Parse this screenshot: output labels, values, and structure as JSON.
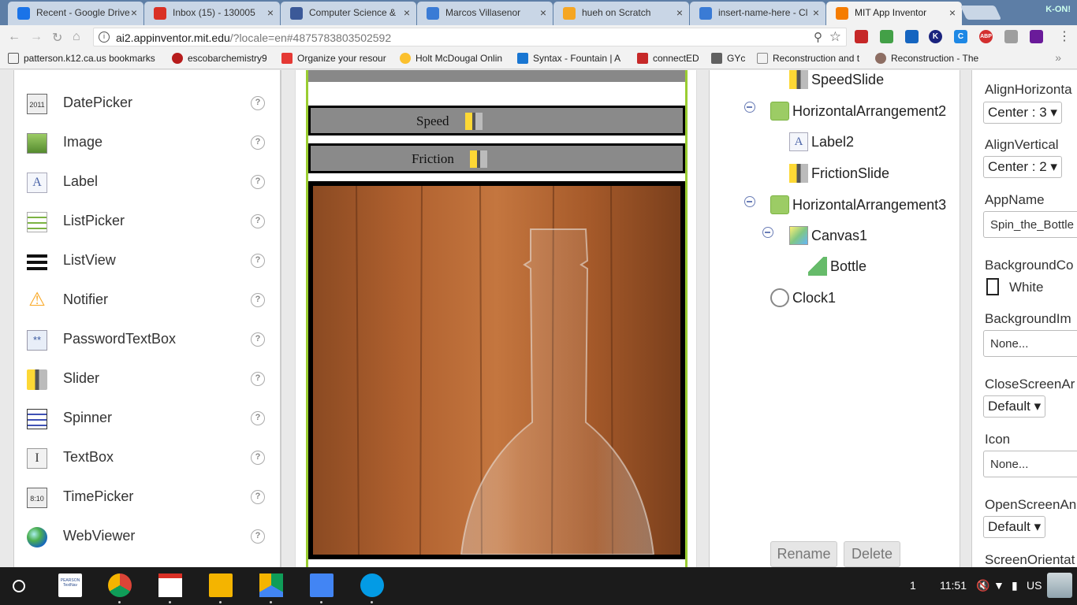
{
  "tabs": [
    {
      "label": "Recent - Google Drive",
      "color": "#1a73e8"
    },
    {
      "label": "Inbox (15) - 130005",
      "color": "#d93025"
    },
    {
      "label": "Computer Science &",
      "color": "#3b5998"
    },
    {
      "label": "Marcos Villasenor",
      "color": "#3a7bd5"
    },
    {
      "label": "hueh on Scratch",
      "color": "#f5a623"
    },
    {
      "label": "insert-name-here - Cl",
      "color": "#3a7bd5"
    },
    {
      "label": "MIT App Inventor",
      "color": "#f57c00"
    }
  ],
  "window_badge": "K-ON!",
  "address": {
    "host": "ai2.appinventor.mit.edu",
    "path": "/?locale=en#4875783803502592"
  },
  "bookmarks": [
    "patterson.k12.ca.us bookmarks",
    "escobarchemistry9",
    "Organize your resour",
    "Holt McDougal Onlin",
    "Syntax - Fountain | A",
    "connectED",
    "GYc",
    "Reconstruction and t",
    "Reconstruction - The"
  ],
  "bookmarks_overflow": "»",
  "palette": {
    "items": [
      {
        "label": "DatePicker",
        "icon": "datepicker-icon"
      },
      {
        "label": "Image",
        "icon": "image-icon"
      },
      {
        "label": "Label",
        "icon": "label-icon"
      },
      {
        "label": "ListPicker",
        "icon": "listpicker-icon"
      },
      {
        "label": "ListView",
        "icon": "listview-icon"
      },
      {
        "label": "Notifier",
        "icon": "notifier-icon"
      },
      {
        "label": "PasswordTextBox",
        "icon": "passwordtextbox-icon"
      },
      {
        "label": "Slider",
        "icon": "slider-icon"
      },
      {
        "label": "Spinner",
        "icon": "spinner-icon"
      },
      {
        "label": "TextBox",
        "icon": "textbox-icon"
      },
      {
        "label": "TimePicker",
        "icon": "timepicker-icon"
      },
      {
        "label": "WebViewer",
        "icon": "webviewer-icon"
      }
    ],
    "help": "?",
    "datepicker_glyph": "2011",
    "timepicker_glyph": "8:10"
  },
  "viewer": {
    "speed_label": "Speed",
    "friction_label": "Friction"
  },
  "tree": {
    "nodes": [
      {
        "label": "SpeedSlide",
        "icon": "slider-icon"
      },
      {
        "label": "HorizontalArrangement2",
        "icon": "horizontal-arrangement-icon"
      },
      {
        "label": "Label2",
        "icon": "label-icon"
      },
      {
        "label": "FrictionSlide",
        "icon": "slider-icon"
      },
      {
        "label": "HorizontalArrangement3",
        "icon": "horizontal-arrangement-icon"
      },
      {
        "label": "Canvas1",
        "icon": "canvas-icon"
      },
      {
        "label": "Bottle",
        "icon": "imagesprite-icon"
      },
      {
        "label": "Clock1",
        "icon": "clock-icon"
      }
    ],
    "rename": "Rename",
    "delete": "Delete"
  },
  "properties": {
    "align_horizontal_label": "AlignHorizonta",
    "align_horizontal_value": "Center : 3 ▾",
    "align_vertical_label": "AlignVertical",
    "align_vertical_value": "Center : 2 ▾",
    "app_name_label": "AppName",
    "app_name_value": "Spin_the_Bottle",
    "bg_color_label": "BackgroundCo",
    "bg_color_value": "White",
    "bg_image_label": "BackgroundIm",
    "bg_image_value": "None...",
    "close_anim_label": "CloseScreenAr",
    "close_anim_value": "Default ▾",
    "icon_label": "Icon",
    "icon_value": "None...",
    "open_anim_label": "OpenScreenAn",
    "open_anim_value": "Default ▾",
    "orientation_label": "ScreenOrientat"
  },
  "shelf": {
    "apps": [
      "textnav",
      "chrome",
      "gmail",
      "slides",
      "drive",
      "docs",
      "files"
    ],
    "textnav_text": "PEARSON TextNav",
    "notification_count": "1",
    "time": "11:51",
    "ime": "US"
  }
}
